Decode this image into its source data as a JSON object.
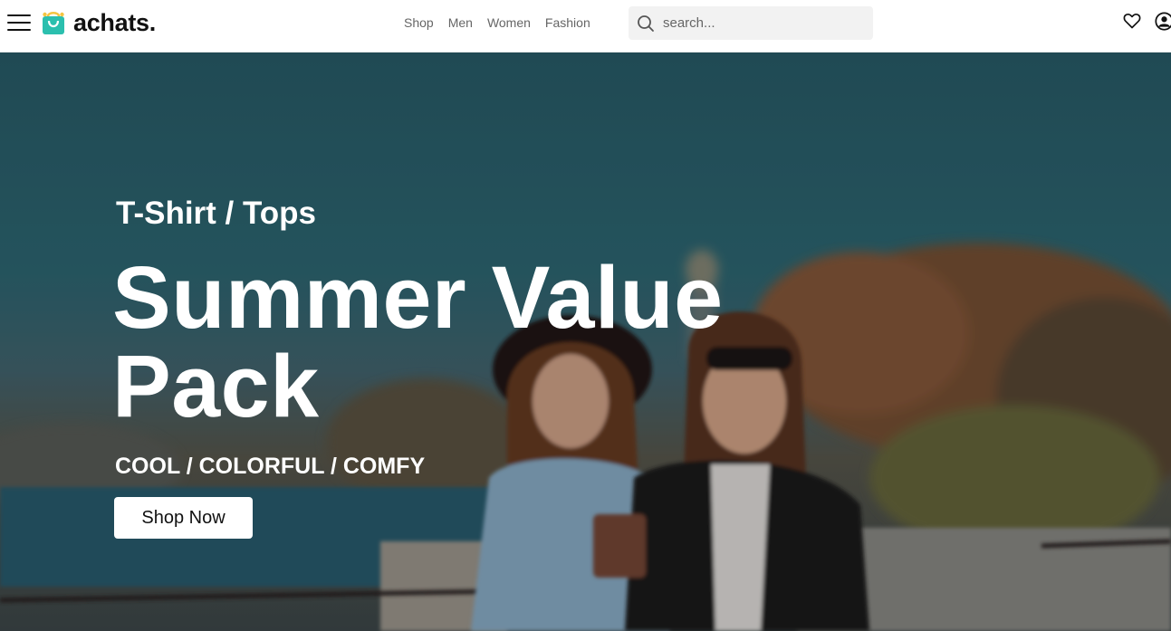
{
  "brand": {
    "name": "achats.",
    "logo_icon": "shopping-bag-icon",
    "logo_color": "#2bbfae"
  },
  "header": {
    "menu_icon": "hamburger-menu-icon",
    "nav": [
      "Shop",
      "Men",
      "Women",
      "Fashion"
    ],
    "search": {
      "placeholder": "search...",
      "value": "",
      "icon": "search-icon"
    },
    "icons": [
      "heart-icon",
      "user-icon"
    ]
  },
  "hero": {
    "subtitle": "T-Shirt / Tops",
    "title": "Summer Value Pack",
    "tagline": "COOL / COLORFUL / COMFY",
    "cta_label": "Shop Now",
    "background": "photo-two-women-walking-waterfront"
  },
  "colors": {
    "header_bg": "#ffffff",
    "nav_text": "#666666",
    "search_bg": "#f2f2f2",
    "hero_text": "#ffffff",
    "button_bg": "#ffffff"
  }
}
